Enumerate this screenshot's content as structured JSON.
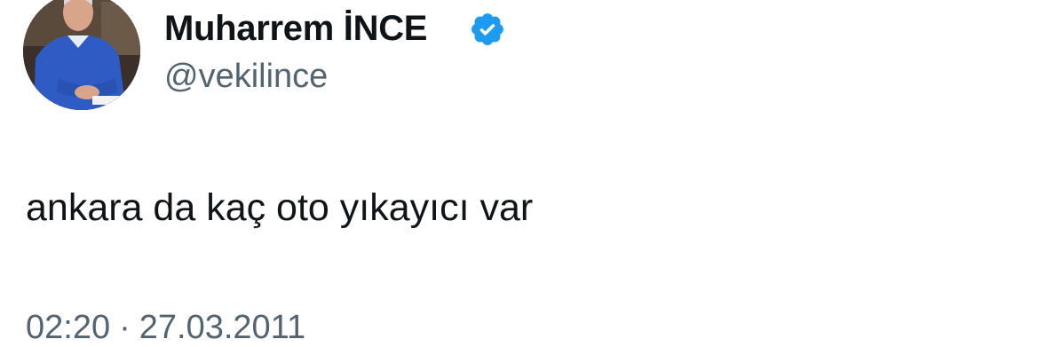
{
  "author": {
    "name": "Muharrem İNCE",
    "handle": "@vekilince",
    "avatar_icon": "profile-photo",
    "verified_icon": "verified-badge-icon",
    "verified_color": "#1d9bf0"
  },
  "tweet": {
    "text": "ankara da kaç oto yıkayıcı var",
    "time": "02:20",
    "separator": "·",
    "date": "27.03.2011"
  },
  "colors": {
    "text_primary": "#0f1419",
    "text_secondary": "#536471",
    "background": "#ffffff"
  }
}
